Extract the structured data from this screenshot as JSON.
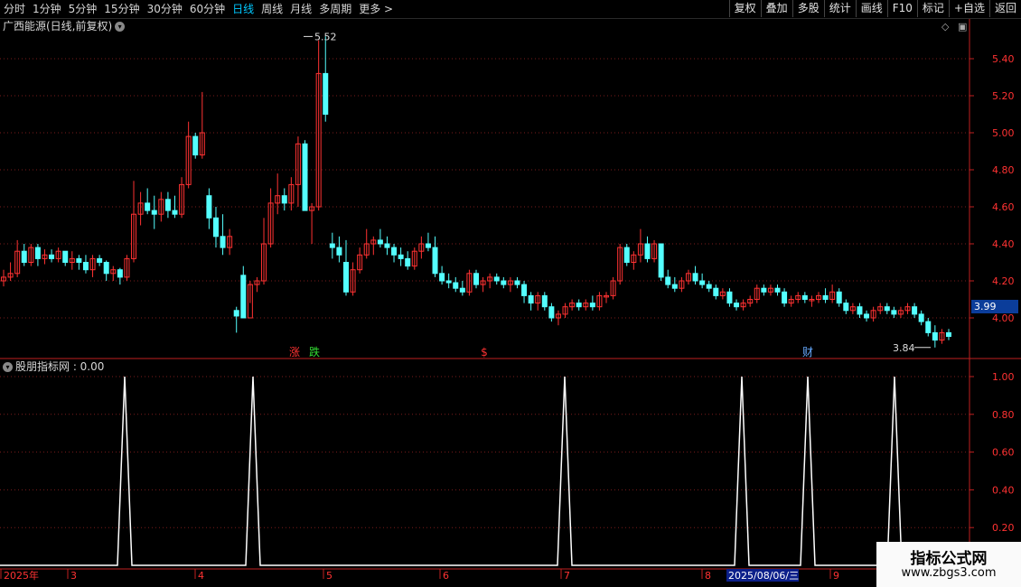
{
  "toolbar": {
    "periods": [
      "分时",
      "1分钟",
      "5分钟",
      "15分钟",
      "30分钟",
      "60分钟",
      "日线",
      "周线",
      "月线",
      "多周期",
      "更多 >"
    ],
    "active_period": "日线",
    "right_buttons": [
      "复权",
      "叠加",
      "多股",
      "统计",
      "画线",
      "F10",
      "标记",
      "+自选",
      "返回"
    ]
  },
  "main_chart": {
    "title": "广西能源(日线,前复权)",
    "price_axis_labels": [
      "5.40",
      "5.20",
      "5.00",
      "4.80",
      "4.60",
      "4.40",
      "4.20",
      "4.00"
    ],
    "current_price": "3.99",
    "high_label": "5.52",
    "low_label": "3.84",
    "markers": [
      "涨",
      "跌",
      "$",
      "财"
    ]
  },
  "indicator": {
    "title": "股朋指标网 : 0.00",
    "axis_labels": [
      "1.00",
      "0.80",
      "0.60",
      "0.40",
      "0.20"
    ],
    "signals": [
      1,
      1,
      1,
      1,
      1,
      1
    ]
  },
  "time_axis": {
    "labels": [
      "2025年",
      "3",
      "4",
      "5",
      "6",
      "7",
      "8",
      "2025/08/06/三",
      "9"
    ]
  },
  "watermark": {
    "title": "指标公式网",
    "url": "www.zbgs3.com"
  },
  "colors": {
    "up": "#ff3232",
    "down": "#54ffff",
    "grid": "#7a1c1c",
    "frame": "#c02020",
    "active_tab": "#00c8ff"
  }
}
